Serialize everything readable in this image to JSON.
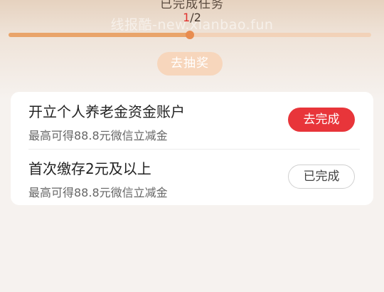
{
  "header": {
    "title": "已完成任务",
    "watermark": "线报酷-new.xianbao.fun",
    "progress": {
      "completed": "1",
      "separator": "/",
      "total": "2",
      "fraction": 0.5
    },
    "draw_button": "去抽奖"
  },
  "tasks": [
    {
      "title": "开立个人养老金资金账户",
      "desc": "最高可得88.8元微信立减金",
      "action": "去完成",
      "status": "todo"
    },
    {
      "title": "首次缴存2元及以上",
      "desc": "最高可得88.8元微信立减金",
      "action": "已完成",
      "status": "done"
    }
  ],
  "colors": {
    "accent": "#e8353a",
    "progress_fill": "#e9a46a",
    "progress_track": "#f2d2b8",
    "draw_button": "#f7d6bc"
  }
}
